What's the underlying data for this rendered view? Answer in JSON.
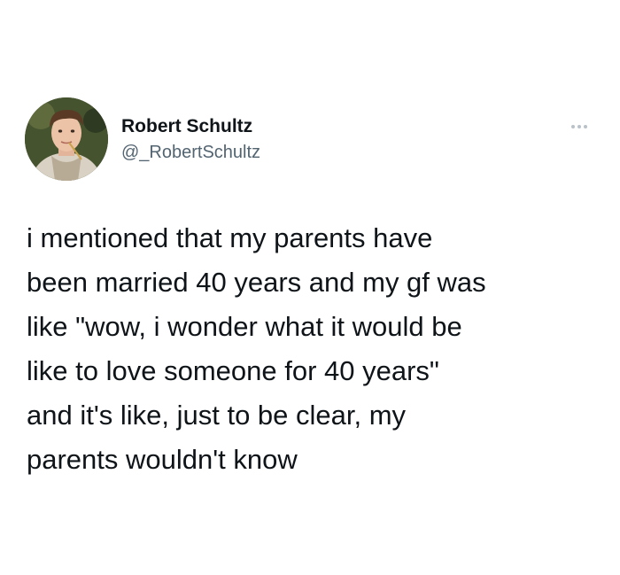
{
  "tweet": {
    "author": {
      "display_name": "Robert Schultz",
      "handle": "@_RobertSchultz",
      "avatar_icon": "user-avatar-photo"
    },
    "more_icon": "more-options-icon",
    "text_lines": [
      "i mentioned that my parents have",
      "been married 40 years and my gf was",
      "like \"wow, i wonder what it would be",
      "like to love someone for 40 years\"",
      "and it's like, just to be clear, my",
      "parents wouldn't know"
    ]
  },
  "colors": {
    "text_primary": "#0f1419",
    "text_secondary": "#536471",
    "more_dots": "#b9c2c9"
  }
}
